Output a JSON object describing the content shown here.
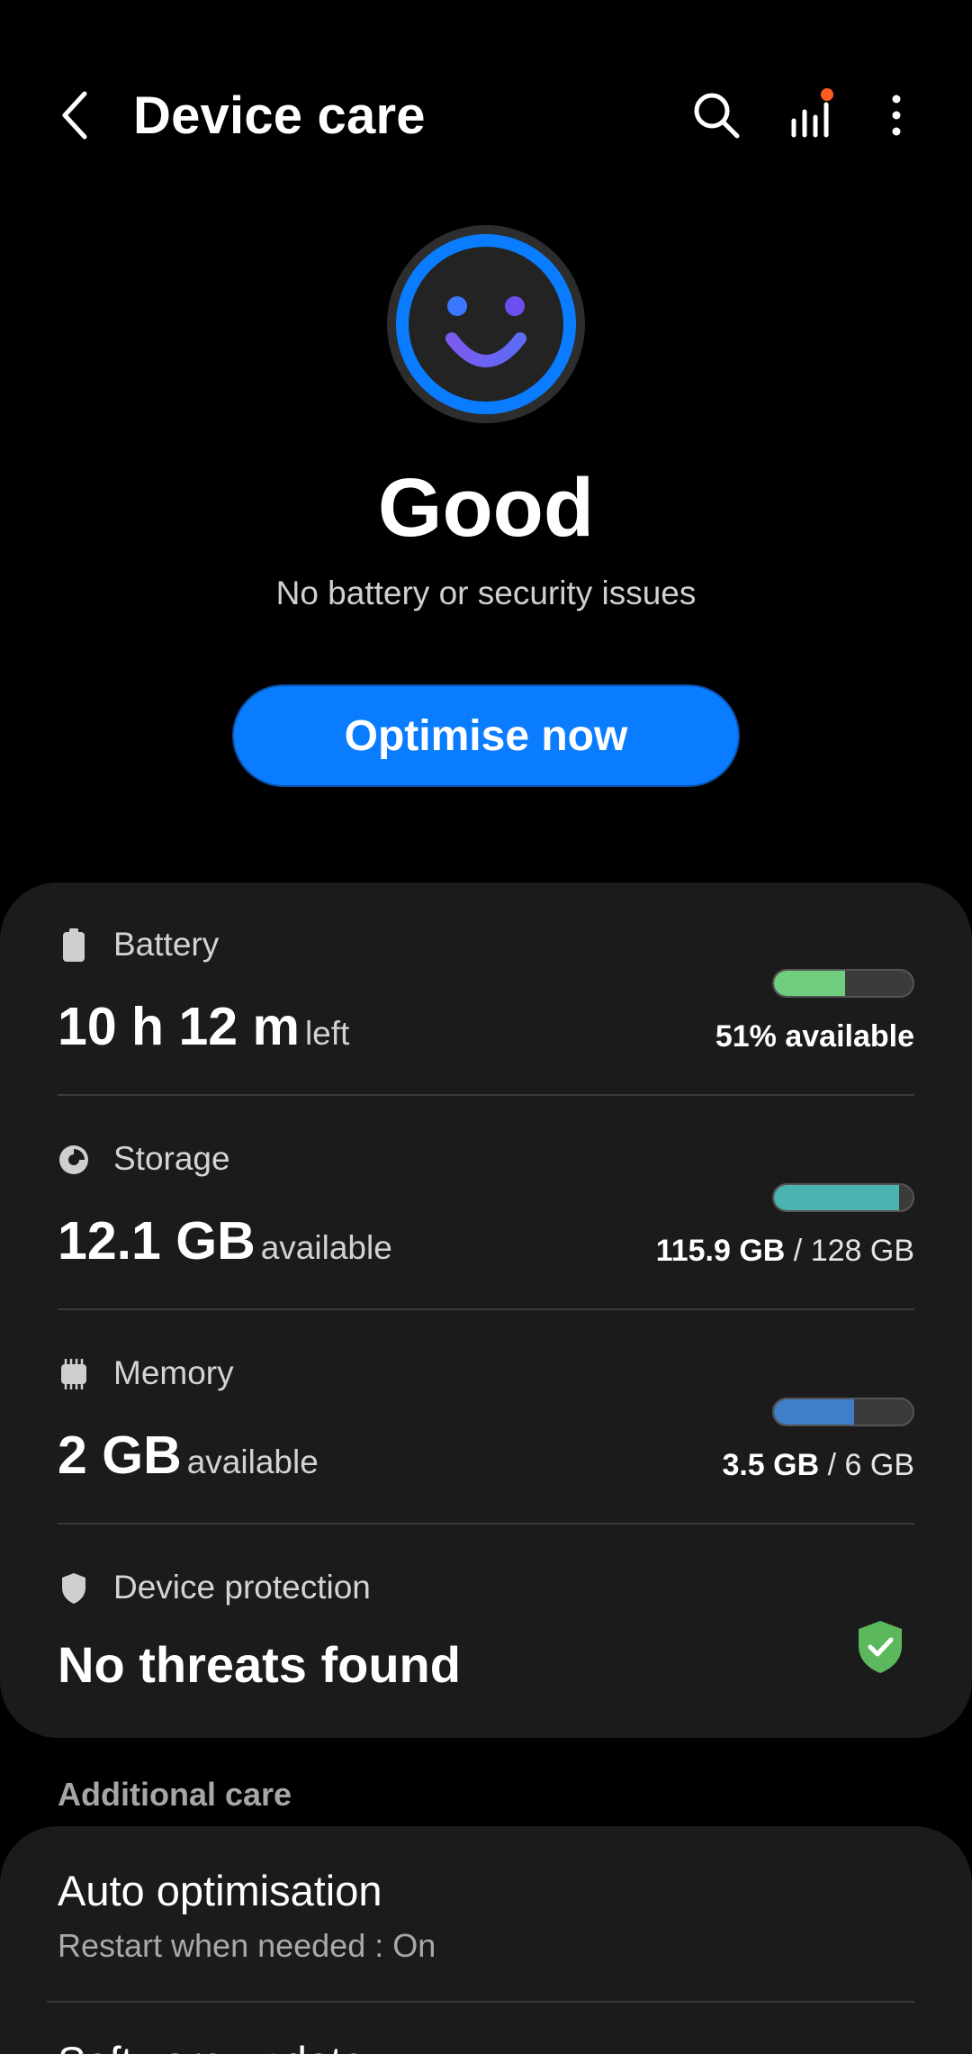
{
  "header": {
    "title": "Device care",
    "back_icon": "back-arrow-icon",
    "search_icon": "search-icon",
    "stats_icon": "bar-chart-icon",
    "more_icon": "more-vertical-icon"
  },
  "status": {
    "face_icon": "smiley-face-icon",
    "word": "Good",
    "subtitle": "No battery or security issues",
    "button_label": "Optimise now"
  },
  "items": {
    "battery": {
      "label": "Battery",
      "icon": "battery-icon",
      "value": "10 h 12 m",
      "unit": "left",
      "progress": 0.51,
      "meter_color": "#6fcf7f",
      "meter_text_bold": "51% available",
      "meter_text_rest": ""
    },
    "storage": {
      "label": "Storage",
      "icon": "pie-chart-icon",
      "value": "12.1 GB",
      "unit": "available",
      "progress": 0.905,
      "meter_color": "#4bb3b0",
      "meter_text_bold": "115.9 GB",
      "meter_text_rest": " / 128 GB"
    },
    "memory": {
      "label": "Memory",
      "icon": "memory-chip-icon",
      "value": "2 GB",
      "unit": "available",
      "progress": 0.58,
      "meter_color": "#3e7fc8",
      "meter_text_bold": "3.5 GB",
      "meter_text_rest": " / 6 GB"
    },
    "protection": {
      "label": "Device protection",
      "icon": "shield-icon",
      "value": "No threats found",
      "status_icon": "shield-check-icon",
      "status_color": "#5cb85c"
    }
  },
  "additional": {
    "section_title": "Additional care",
    "auto_title": "Auto optimisation",
    "auto_sub": "Restart when needed : On",
    "next_title": "Software update"
  },
  "colors": {
    "accent": "#0a7cff",
    "background": "#000000",
    "card": "#1b1b1b"
  }
}
